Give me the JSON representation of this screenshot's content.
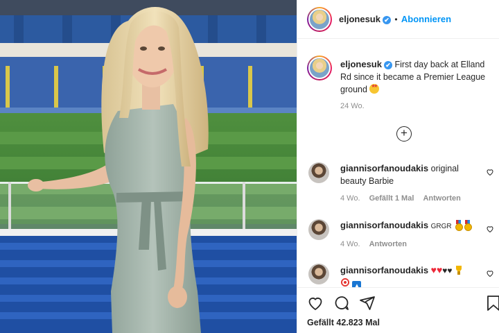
{
  "post": {
    "username": "eljonesuk",
    "verified_badge": "✔",
    "follow_label": "Abonnieren",
    "caption_user": "eljonesuk",
    "caption_text": "First day back at Elland Rd since it became a Premier League ground",
    "caption_time": "24 Wo.",
    "load_more_icon": "plus-circle-icon",
    "likes_label": "Gefällt 42.823 Mal"
  },
  "comments": [
    {
      "user": "giannisorfanoudakis",
      "text": "original beauty Barbie",
      "time": "4 Wo.",
      "likes": "Gefällt 1 Mal",
      "reply": "Antworten"
    },
    {
      "user": "giannisorfanoudakis",
      "text": "GRGR",
      "time": "4 Wo.",
      "reply": "Antworten"
    },
    {
      "user": "giannisorfanoudakis",
      "text": ""
    }
  ],
  "icons": {
    "like": "heart-icon",
    "comment": "comment-icon",
    "share": "send-icon",
    "save": "bookmark-icon"
  },
  "colors": {
    "accent": "#0095f6",
    "text": "#262626",
    "muted": "#8e8e8e",
    "verified": "#3897f0"
  }
}
